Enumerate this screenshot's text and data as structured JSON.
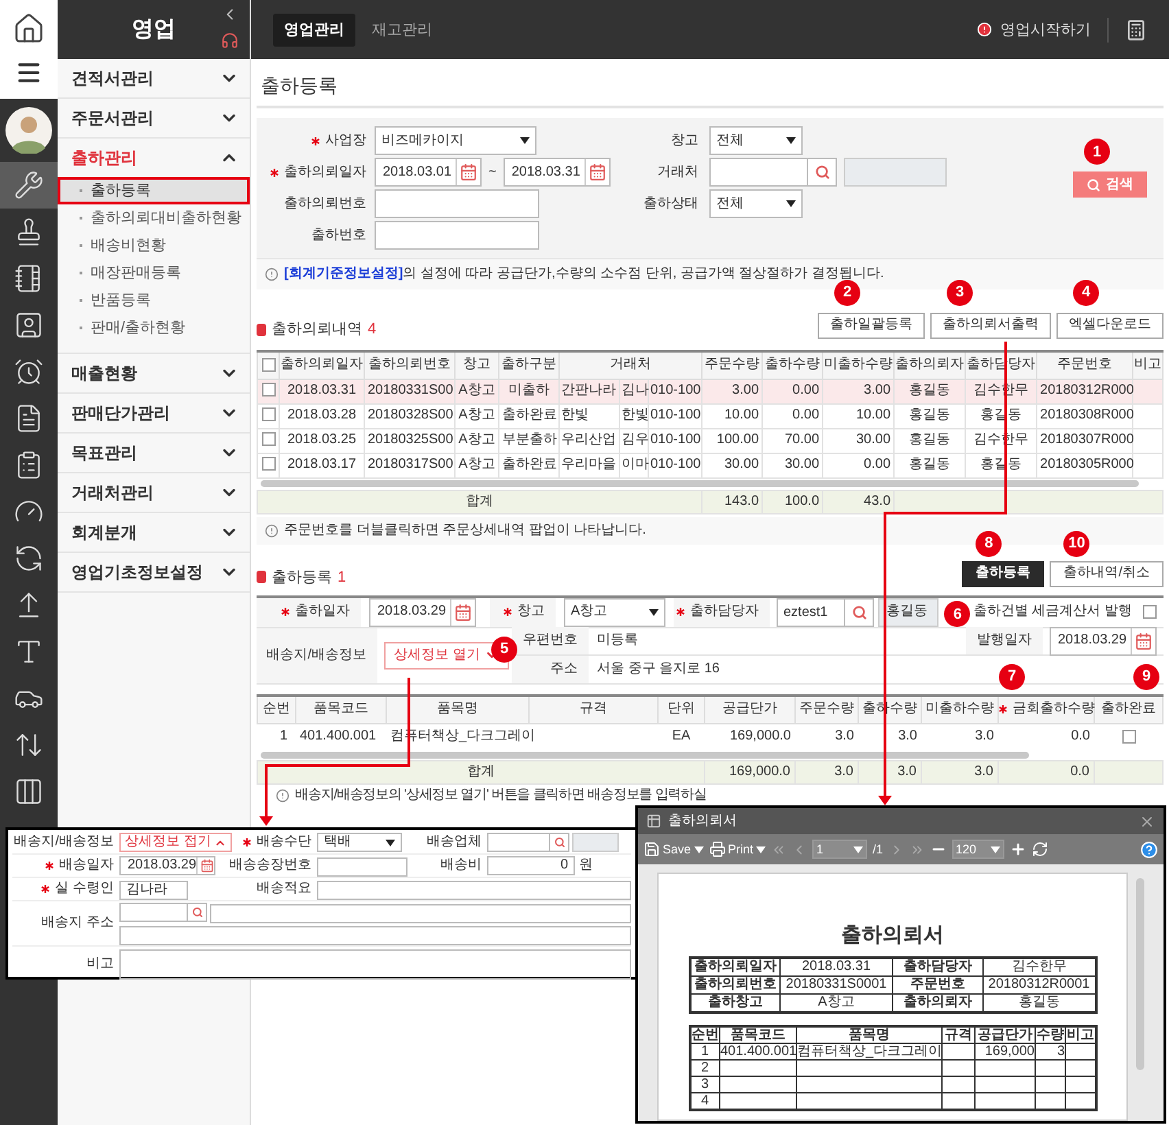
{
  "app": {
    "title": "영업"
  },
  "rail_items": [
    {
      "selected": true
    },
    {
      "selected": false
    },
    {
      "selected": false
    },
    {
      "selected": false
    },
    {
      "selected": false
    },
    {
      "selected": false
    },
    {
      "selected": false
    },
    {
      "selected": false
    },
    {
      "selected": false
    },
    {
      "selected": false
    },
    {
      "selected": false
    },
    {
      "selected": false
    },
    {
      "selected": false
    },
    {
      "selected": false
    }
  ],
  "top_tabs": [
    {
      "label": "영업관리",
      "selected": true
    },
    {
      "label": "재고관리",
      "selected": false
    }
  ],
  "start_link": "영업시작하기",
  "sidebar": {
    "items": [
      {
        "label": "견적서관리",
        "expanded": false
      },
      {
        "label": "주문서관리",
        "expanded": false
      },
      {
        "label": "출하관리",
        "expanded": true,
        "children": [
          {
            "label": "출하등록",
            "selected": true
          },
          {
            "label": "출하의뢰대비출하현황",
            "selected": false
          },
          {
            "label": "배송비현황",
            "selected": false
          },
          {
            "label": "매장판매등록",
            "selected": false
          },
          {
            "label": "반품등록",
            "selected": false
          },
          {
            "label": "판매/출하현황",
            "selected": false
          }
        ]
      },
      {
        "label": "매출현황",
        "expanded": false
      },
      {
        "label": "판매단가관리",
        "expanded": false
      },
      {
        "label": "목표관리",
        "expanded": false
      },
      {
        "label": "거래처관리",
        "expanded": false
      },
      {
        "label": "회계분개",
        "expanded": false
      },
      {
        "label": "영업기초정보설정",
        "expanded": false
      }
    ]
  },
  "page_title": "출하등록",
  "search_form": {
    "left": [
      {
        "label": "사업장",
        "required": true,
        "kind": "select",
        "value": "비즈메카이지"
      },
      {
        "label": "출하의뢰일자",
        "required": true,
        "kind": "daterange",
        "from": "2018.03.01",
        "sep": "~",
        "to": "2018.03.31"
      },
      {
        "label": "출하의뢰번호",
        "required": false,
        "kind": "text"
      },
      {
        "label": "출하번호",
        "required": false,
        "kind": "text"
      }
    ],
    "right": [
      {
        "label": "창고",
        "kind": "select",
        "value": "전체"
      },
      {
        "label": "거래처",
        "kind": "lookup"
      },
      {
        "label": "출하상태",
        "kind": "select",
        "value": "전체"
      }
    ],
    "search_button": {
      "label": "검색",
      "callout": "1"
    },
    "note": {
      "link": "[회계기준정보설정]",
      "text": "의 설정에 따라 공급단가,수량의 소수점 단위, 공급가액 절상절하가 결정됩니다."
    }
  },
  "requests": {
    "title": "출하의뢰내역",
    "count": "4",
    "buttons": [
      {
        "label": "출하일괄등록",
        "callout": "2"
      },
      {
        "label": "출하의뢰서출력",
        "callout": "3"
      },
      {
        "label": "엑셀다운로드",
        "callout": "4"
      }
    ],
    "header_checked": false,
    "columns": [
      "출하의뢰일자",
      "출하의뢰번호",
      "창고",
      "출하구분",
      "거래처",
      "주문수량",
      "출하수량",
      "미출하수량",
      "출하의뢰자",
      "출하담당자",
      "주문번호",
      "비고"
    ],
    "rows": [
      {
        "selected": true,
        "checked": false,
        "cells": [
          "2018.03.31",
          "20180331S00",
          "A창고",
          "미출하",
          [
            "간판나라",
            "김나",
            "010-100"
          ],
          "3.00",
          "0.00",
          "3.00",
          "홍길동",
          "김수한무",
          "20180312R000"
        ]
      },
      {
        "selected": false,
        "checked": false,
        "cells": [
          "2018.03.28",
          "20180328S00",
          "A창고",
          "출하완료",
          [
            "한빛",
            "한빛",
            "010-100"
          ],
          "10.00",
          "0.00",
          "10.00",
          "홍길동",
          "홍길동",
          "20180308R000"
        ]
      },
      {
        "selected": false,
        "checked": false,
        "cells": [
          "2018.03.25",
          "20180325S00",
          "A창고",
          "부분출하",
          [
            "우리산업",
            "김우",
            "010-100"
          ],
          "100.00",
          "70.00",
          "30.00",
          "홍길동",
          "김수한무",
          "20180307R000"
        ]
      },
      {
        "selected": false,
        "checked": false,
        "cells": [
          "2018.03.17",
          "20180317S00",
          "A창고",
          "출하완료",
          [
            "우리마을",
            "이마",
            "010-100"
          ],
          "30.00",
          "30.00",
          "0.00",
          "홍길동",
          "홍길동",
          "20180305R000"
        ]
      }
    ],
    "totals": {
      "label": "합계",
      "values": [
        "143.0",
        "100.0",
        "43.0"
      ]
    },
    "note": "주문번호를 더블클릭하면 주문상세내역 팝업이 나타납니다."
  },
  "shipment": {
    "title": "출하등록",
    "count": "1",
    "buttons": [
      {
        "label": "출하등록",
        "kind": "primary",
        "callout": "8"
      },
      {
        "label": "출하내역/취소",
        "kind": "default",
        "callout": "10"
      }
    ],
    "ship_date": {
      "label": "출하일자",
      "required": true,
      "value": "2018.03.29"
    },
    "warehouse": {
      "label": "창고",
      "required": true,
      "value": "A창고"
    },
    "manager": {
      "label": "출하담당자",
      "required": true,
      "value": "eztest1",
      "name": "홍길동"
    },
    "tax_invoice": {
      "label": "출하건별 세금계산서 발행",
      "checked": false,
      "callout": "6"
    },
    "delivery": {
      "label": "배송지/배송정보",
      "button": "상세정보 열기",
      "callout": "5"
    },
    "zip": {
      "label": "우편번호",
      "value": "미등록"
    },
    "issue_date": {
      "label": "발행일자",
      "value": "2018.03.29"
    },
    "address": {
      "label": "주소",
      "value": "서울 중구 을지로 16"
    },
    "columns": [
      {
        "label": "순번"
      },
      {
        "label": "품목코드"
      },
      {
        "label": "품목명"
      },
      {
        "label": "규격"
      },
      {
        "label": "단위"
      },
      {
        "label": "공급단가"
      },
      {
        "label": "주문수량"
      },
      {
        "label": "출하수량"
      },
      {
        "label": "미출하수량"
      },
      {
        "label": "금회출하수량",
        "required": true,
        "callout": "7"
      },
      {
        "label": "출하완료",
        "callout": "9"
      }
    ],
    "rows": [
      {
        "no": "1",
        "code": "401.400.001",
        "name": "컴퓨터책상_다크그레이",
        "unit": "EA",
        "price": "169,000.0",
        "ordered": "3.0",
        "shipped": "3.0",
        "remaining": "3.0",
        "current": "0.0",
        "done": false
      }
    ],
    "totals": {
      "label": "합계",
      "price": "169,000.0",
      "ordered": "3.0",
      "shipped": "3.0",
      "remaining": "3.0",
      "current": "0.0"
    },
    "note": "배송지/배송정보의 '상세정보 열기' 버튼을 클릭하면 배송정보를 입력하실"
  },
  "delivery_popup": {
    "label": "배송지/배송정보",
    "toggle": "상세정보 접기",
    "method": {
      "label": "배송수단",
      "required": true,
      "value": "택배"
    },
    "carrier": {
      "label": "배송업체"
    },
    "date": {
      "label": "배송일자",
      "required": true,
      "value": "2018.03.29"
    },
    "tracking": {
      "label": "배송송장번호"
    },
    "fee": {
      "label": "배송비",
      "value": "0",
      "unit": "원"
    },
    "receiver": {
      "label": "실 수령인",
      "required": true,
      "value": "김나라"
    },
    "memo": {
      "label": "배송적요"
    },
    "address": {
      "label": "배송지 주소"
    },
    "remarks": {
      "label": "비고"
    }
  },
  "print_popup": {
    "title": "출하의뢰서",
    "toolbar": {
      "save": "Save",
      "print": "Print",
      "page": "1",
      "pages": "/1",
      "zoom": "120"
    },
    "document": {
      "title": "출하의뢰서",
      "info": [
        {
          "label": "출하의뢰일자",
          "value": "2018.03.31",
          "label2": "출하담당자",
          "value2": "김수한무"
        },
        {
          "label": "출하의뢰번호",
          "value": "20180331S0001",
          "label2": "주문번호",
          "value2": "20180312R0001"
        },
        {
          "label": "출하창고",
          "value": "A창고",
          "label2": "출하의뢰자",
          "value2": "홍길동"
        }
      ],
      "columns": [
        "순번",
        "품목코드",
        "품목명",
        "규격",
        "공급단가",
        "수량",
        "비고"
      ],
      "rows": [
        {
          "no": "1",
          "code": "401.400.001",
          "name": "컴퓨터책상_다크그레이",
          "price": "169,000",
          "qty": "3"
        },
        {
          "no": "2"
        },
        {
          "no": "3"
        },
        {
          "no": "4"
        }
      ]
    }
  }
}
